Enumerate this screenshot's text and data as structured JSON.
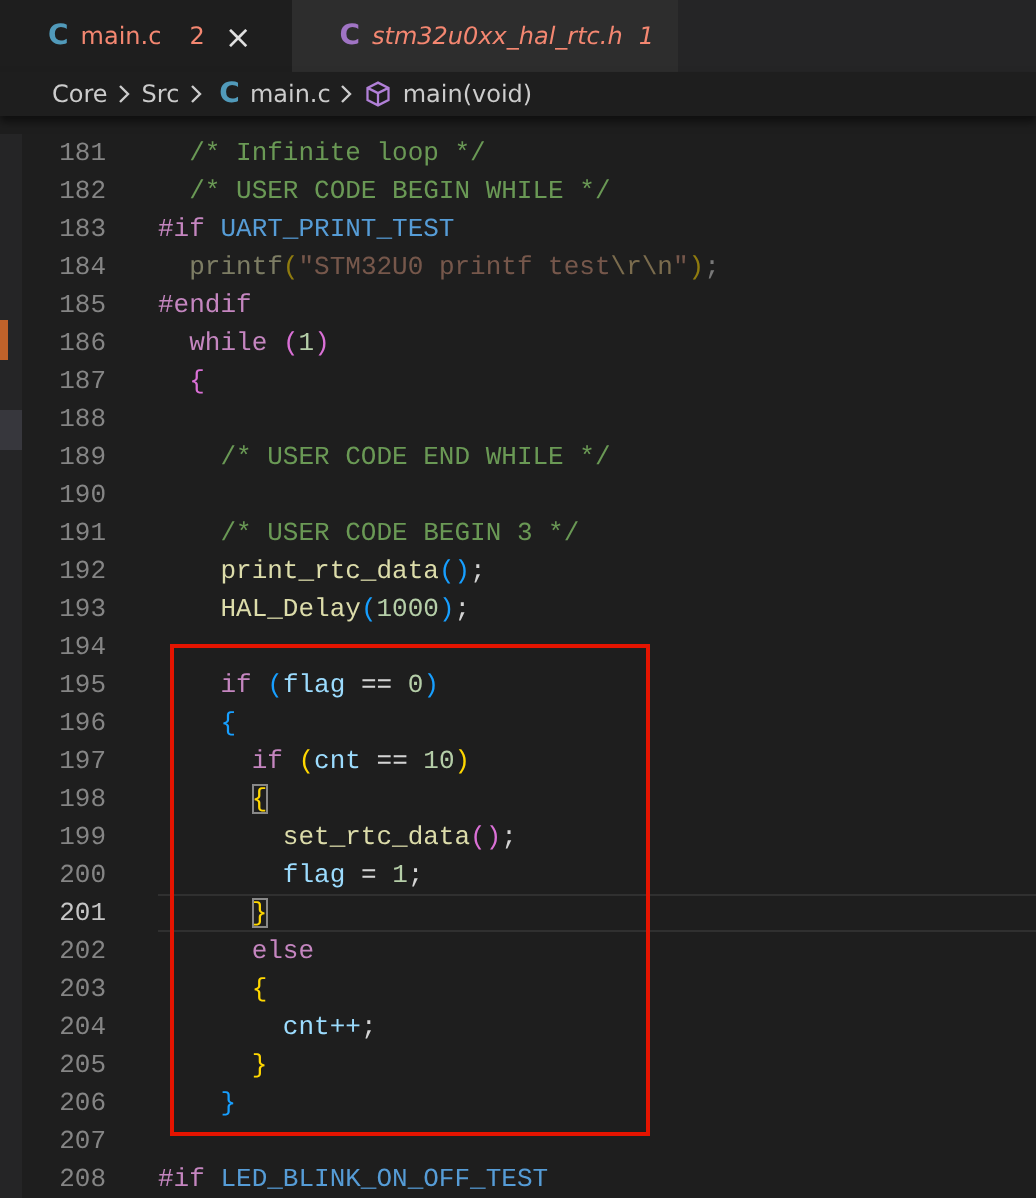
{
  "tabs": [
    {
      "icon_letter": "C",
      "color": "#519aba",
      "label": "main.c",
      "problems": "2",
      "selected": true,
      "preview": false,
      "close": "×"
    },
    {
      "icon_letter": "C",
      "color": "#a074c4",
      "label": "stm32u0xx_hal_rtc.h",
      "problems": "1",
      "selected": false,
      "preview": true
    }
  ],
  "breadcrumb": [
    {
      "kind": "folder",
      "label": "Core"
    },
    {
      "kind": "folder",
      "label": "Src"
    },
    {
      "kind": "file",
      "icon_letter": "C",
      "label": "main.c"
    },
    {
      "kind": "symbol",
      "label": "main(void)"
    }
  ],
  "lines": [
    {
      "number": "181",
      "current": false,
      "inactive": false,
      "tokens": [
        {
          "text": "  /* Infinite loop */",
          "kind": "comment"
        }
      ]
    },
    {
      "number": "182",
      "current": false,
      "inactive": false,
      "tokens": [
        {
          "text": "  /* USER CODE BEGIN WHILE */",
          "kind": "comment"
        }
      ]
    },
    {
      "number": "183",
      "current": false,
      "inactive": false,
      "tokens": [
        {
          "text": "#if",
          "kind": "preproc"
        },
        {
          "text": " UART_PRINT_TEST",
          "kind": "macro"
        }
      ]
    },
    {
      "number": "184",
      "current": false,
      "inactive": true,
      "tokens": [
        {
          "text": "  printf",
          "kind": "function"
        },
        {
          "text": "(",
          "kind": "bracket1"
        },
        {
          "text": "\"STM32U0 printf test",
          "kind": "string"
        },
        {
          "text": "\\r\\n",
          "kind": "escape"
        },
        {
          "text": "\"",
          "kind": "string"
        },
        {
          "text": ")",
          "kind": "bracket1"
        },
        {
          "text": ";",
          "kind": "plain"
        }
      ]
    },
    {
      "number": "185",
      "current": false,
      "inactive": false,
      "tokens": [
        {
          "text": "#endif",
          "kind": "preproc"
        }
      ]
    },
    {
      "number": "186",
      "current": false,
      "inactive": false,
      "tokens": [
        {
          "text": "  while",
          "kind": "keyword"
        },
        {
          "text": " (",
          "kind": "bracket2"
        },
        {
          "text": "1",
          "kind": "number"
        },
        {
          "text": ")",
          "kind": "bracket2"
        }
      ]
    },
    {
      "number": "187",
      "current": false,
      "inactive": false,
      "tokens": [
        {
          "text": "  {",
          "kind": "bracket2"
        }
      ]
    },
    {
      "number": "188",
      "current": false
    },
    {
      "number": "189",
      "current": false,
      "inactive": false,
      "tokens": [
        {
          "text": "    /* USER CODE END WHILE */",
          "kind": "comment"
        }
      ]
    },
    {
      "number": "190",
      "current": false
    },
    {
      "number": "191",
      "current": false,
      "inactive": false,
      "tokens": [
        {
          "text": "    /* USER CODE BEGIN 3 */",
          "kind": "comment"
        }
      ]
    },
    {
      "number": "192",
      "current": false,
      "inactive": false,
      "tokens": [
        {
          "text": "    print_rtc_data",
          "kind": "function"
        },
        {
          "text": "()",
          "kind": "bracket3"
        },
        {
          "text": ";",
          "kind": "plain"
        }
      ]
    },
    {
      "number": "193",
      "current": false,
      "inactive": false,
      "tokens": [
        {
          "text": "    HAL_Delay",
          "kind": "function"
        },
        {
          "text": "(",
          "kind": "bracket3"
        },
        {
          "text": "1000",
          "kind": "number"
        },
        {
          "text": ")",
          "kind": "bracket3"
        },
        {
          "text": ";",
          "kind": "plain"
        }
      ]
    },
    {
      "number": "194",
      "current": false
    },
    {
      "number": "195",
      "current": false,
      "inactive": false,
      "tokens": [
        {
          "text": "    if",
          "kind": "keyword"
        },
        {
          "text": " (",
          "kind": "bracket3"
        },
        {
          "text": "flag",
          "kind": "variable"
        },
        {
          "text": " == ",
          "kind": "plain"
        },
        {
          "text": "0",
          "kind": "number"
        },
        {
          "text": ")",
          "kind": "bracket3"
        }
      ]
    },
    {
      "number": "196",
      "current": false,
      "inactive": false,
      "tokens": [
        {
          "text": "    {",
          "kind": "bracket3"
        }
      ]
    },
    {
      "number": "197",
      "current": false,
      "inactive": false,
      "tokens": [
        {
          "text": "      if",
          "kind": "keyword"
        },
        {
          "text": " (",
          "kind": "bracket1"
        },
        {
          "text": "cnt",
          "kind": "variable"
        },
        {
          "text": " == ",
          "kind": "plain"
        },
        {
          "text": "10",
          "kind": "number"
        },
        {
          "text": ")",
          "kind": "bracket1"
        }
      ]
    },
    {
      "number": "198",
      "current": false,
      "inactive": false,
      "tokens": [
        {
          "text": "      {",
          "kind": "match"
        }
      ]
    },
    {
      "number": "199",
      "current": false,
      "inactive": false,
      "tokens": [
        {
          "text": "        set_rtc_data",
          "kind": "function"
        },
        {
          "text": "()",
          "kind": "bracket2"
        },
        {
          "text": ";",
          "kind": "plain"
        }
      ]
    },
    {
      "number": "200",
      "current": false,
      "inactive": false,
      "tokens": [
        {
          "text": "        flag",
          "kind": "variable"
        },
        {
          "text": " = ",
          "kind": "plain"
        },
        {
          "text": "1",
          "kind": "number"
        },
        {
          "text": ";",
          "kind": "plain"
        }
      ]
    },
    {
      "number": "201",
      "current": true,
      "inactive": false,
      "tokens": [
        {
          "text": "      }",
          "kind": "match"
        }
      ]
    },
    {
      "number": "202",
      "current": false,
      "inactive": false,
      "tokens": [
        {
          "text": "      else",
          "kind": "keyword"
        }
      ]
    },
    {
      "number": "203",
      "current": false,
      "inactive": false,
      "tokens": [
        {
          "text": "      {",
          "kind": "bracket1"
        }
      ]
    },
    {
      "number": "204",
      "current": false,
      "inactive": false,
      "tokens": [
        {
          "text": "        cnt++",
          "kind": "variable"
        },
        {
          "text": ";",
          "kind": "plain"
        }
      ]
    },
    {
      "number": "205",
      "current": false,
      "inactive": false,
      "tokens": [
        {
          "text": "      }",
          "kind": "bracket1"
        }
      ]
    },
    {
      "number": "206",
      "current": false,
      "inactive": false,
      "tokens": [
        {
          "text": "    }",
          "kind": "bracket3"
        }
      ]
    },
    {
      "number": "207",
      "current": false
    },
    {
      "number": "208",
      "current": false,
      "inactive": false,
      "tokens": [
        {
          "text": "#if",
          "kind": "preproc"
        },
        {
          "text": " LED_BLINK_ON_OFF_TEST",
          "kind": "macro"
        }
      ]
    }
  ]
}
